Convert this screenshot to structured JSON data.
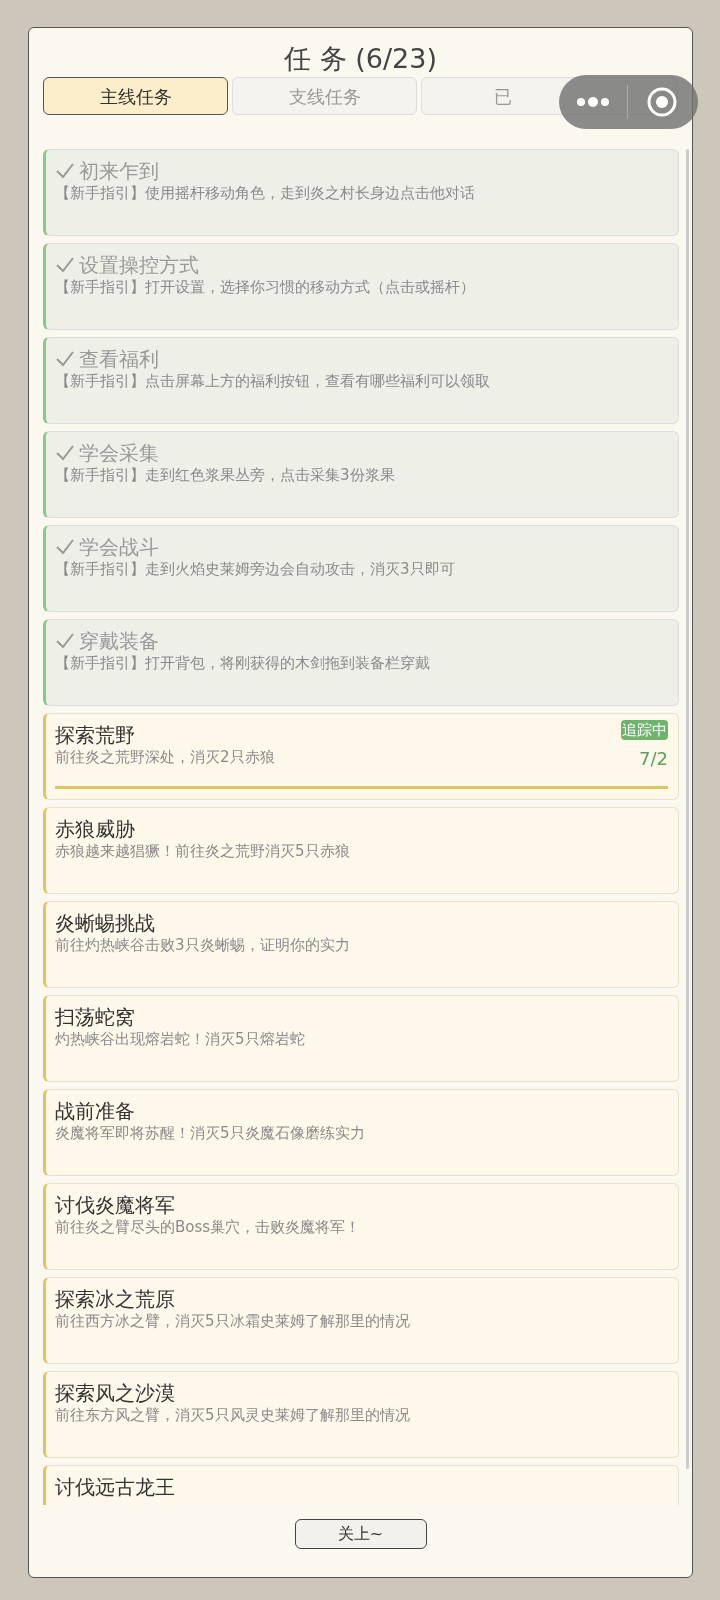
{
  "title": "任 务 (6/23)",
  "tabs": [
    {
      "label": "主线任务",
      "selected": true
    },
    {
      "label": "支线任务",
      "selected": false
    },
    {
      "label": "已",
      "selected": false
    }
  ],
  "tasks": [
    {
      "title": "初来乍到",
      "description": "【新手指引】使用摇杆移动角色，走到炎之村长身边点击他对话",
      "completed": true
    },
    {
      "title": "设置操控方式",
      "description": "【新手指引】打开设置，选择你习惯的移动方式（点击或摇杆）",
      "completed": true
    },
    {
      "title": "查看福利",
      "description": "【新手指引】点击屏幕上方的福利按钮，查看有哪些福利可以领取",
      "completed": true
    },
    {
      "title": "学会采集",
      "description": "【新手指引】走到红色浆果丛旁，点击采集3份浆果",
      "completed": true
    },
    {
      "title": "学会战斗",
      "description": "【新手指引】走到火焰史莱姆旁边会自动攻击，消灭3只即可",
      "completed": true
    },
    {
      "title": "穿戴装备",
      "description": "【新手指引】打开背包，将刚获得的木剑拖到装备栏穿戴",
      "completed": true
    },
    {
      "title": "探索荒野",
      "description": "前往炎之荒野深处，消灭2只赤狼",
      "completed": false,
      "tracked": true,
      "badge": "追踪中",
      "progress": "7/2",
      "level": 1
    },
    {
      "title": "赤狼威胁",
      "description": "赤狼越来越猖獗！前往炎之荒野消灭5只赤狼",
      "completed": false
    },
    {
      "title": "炎蜥蜴挑战",
      "description": "前往灼热峡谷击败3只炎蜥蜴，证明你的实力",
      "completed": false
    },
    {
      "title": "扫荡蛇窝",
      "description": "灼热峡谷出现熔岩蛇！消灭5只熔岩蛇",
      "completed": false
    },
    {
      "title": "战前准备",
      "description": "炎魔将军即将苏醒！消灭5只炎魔石像磨练实力",
      "completed": false
    },
    {
      "title": "讨伐炎魔将军",
      "description": "前往炎之臂尽头的Boss巢穴，击败炎魔将军！",
      "completed": false
    },
    {
      "title": "探索冰之荒原",
      "description": "前往西方冰之臂，消灭5只冰霜史莱姆了解那里的情况",
      "completed": false
    },
    {
      "title": "探索风之沙漠",
      "description": "前往东方风之臂，消灭5只风灵史莱姆了解那里的情况",
      "completed": false
    },
    {
      "title": "讨伐远古龙王",
      "completed": false
    }
  ],
  "close_button": "关上~"
}
